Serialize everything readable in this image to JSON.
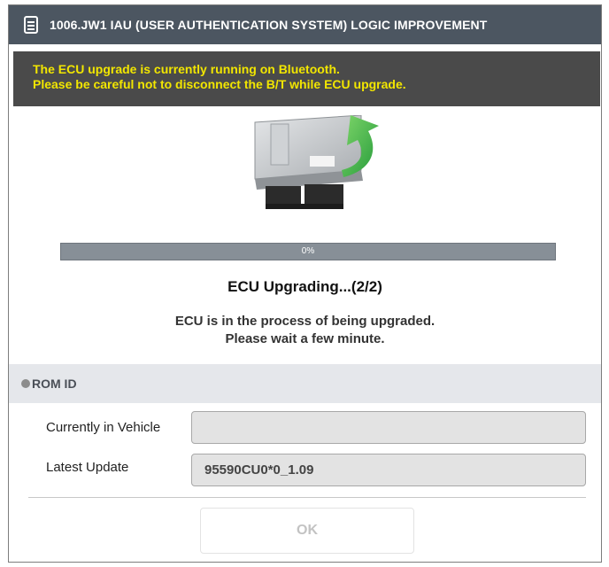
{
  "window": {
    "title": "1006.JW1 IAU (USER AUTHENTICATION SYSTEM) LOGIC IMPROVEMENT",
    "title_icon": "document-list-icon"
  },
  "warning": {
    "line1": "The ECU upgrade is currently running on Bluetooth.",
    "line2": "Please be careful not to disconnect the B/T while ECU upgrade.",
    "text_color": "#f2e600"
  },
  "illustration": {
    "icon": "ecu-upgrade-icon"
  },
  "progress": {
    "value": 0,
    "label": "0%"
  },
  "status": {
    "title": "ECU Upgrading...(2/2)",
    "line1": "ECU is in the process of being upgraded.",
    "line2": "Please wait a few minute."
  },
  "rom": {
    "header": "ROM ID",
    "current_label": "Currently in Vehicle",
    "current_value": "",
    "latest_label": "Latest Update",
    "latest_value": "95590CU0*0_1.09"
  },
  "actions": {
    "ok_label": "OK"
  },
  "colors": {
    "titlebar": "#4c5661",
    "warning_bg": "#4a4a4a",
    "progress_bg": "#878f97",
    "rom_header_bg": "#e5e7eb"
  }
}
